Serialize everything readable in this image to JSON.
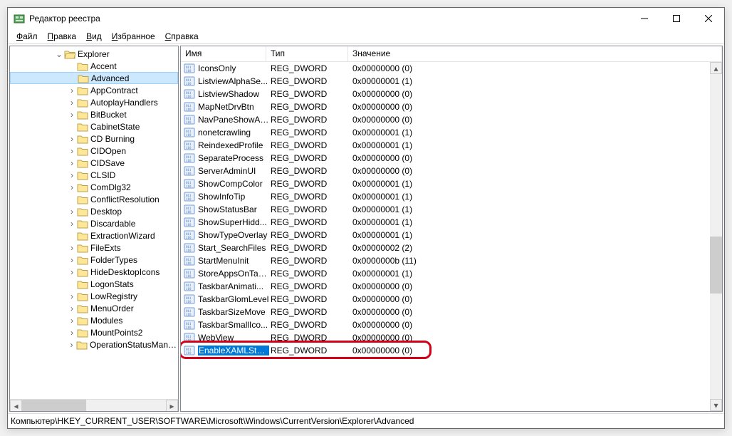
{
  "window": {
    "title": "Редактор реестра"
  },
  "menu": {
    "file": "Файл",
    "edit": "Правка",
    "view": "Вид",
    "favorites": "Избранное",
    "help": "Справка"
  },
  "tree": {
    "root": "Explorer",
    "items": [
      {
        "label": "Accent",
        "exp": ""
      },
      {
        "label": "Advanced",
        "exp": "",
        "selected": true
      },
      {
        "label": "AppContract",
        "exp": ">"
      },
      {
        "label": "AutoplayHandlers",
        "exp": ">"
      },
      {
        "label": "BitBucket",
        "exp": ">"
      },
      {
        "label": "CabinetState",
        "exp": ""
      },
      {
        "label": "CD Burning",
        "exp": ">"
      },
      {
        "label": "CIDOpen",
        "exp": ">"
      },
      {
        "label": "CIDSave",
        "exp": ">"
      },
      {
        "label": "CLSID",
        "exp": ">"
      },
      {
        "label": "ComDlg32",
        "exp": ">"
      },
      {
        "label": "ConflictResolution",
        "exp": ""
      },
      {
        "label": "Desktop",
        "exp": ">"
      },
      {
        "label": "Discardable",
        "exp": ">"
      },
      {
        "label": "ExtractionWizard",
        "exp": ""
      },
      {
        "label": "FileExts",
        "exp": ">"
      },
      {
        "label": "FolderTypes",
        "exp": ">"
      },
      {
        "label": "HideDesktopIcons",
        "exp": ">"
      },
      {
        "label": "LogonStats",
        "exp": ""
      },
      {
        "label": "LowRegistry",
        "exp": ">"
      },
      {
        "label": "MenuOrder",
        "exp": ">"
      },
      {
        "label": "Modules",
        "exp": ">"
      },
      {
        "label": "MountPoints2",
        "exp": ">"
      },
      {
        "label": "OperationStatusManager",
        "exp": ">"
      }
    ]
  },
  "columns": {
    "name": "Имя",
    "type": "Тип",
    "value": "Значение"
  },
  "values": [
    {
      "name": "IconsOnly",
      "type": "REG_DWORD",
      "data": "0x00000000 (0)"
    },
    {
      "name": "ListviewAlphaSe...",
      "type": "REG_DWORD",
      "data": "0x00000001 (1)"
    },
    {
      "name": "ListviewShadow",
      "type": "REG_DWORD",
      "data": "0x00000000 (0)"
    },
    {
      "name": "MapNetDrvBtn",
      "type": "REG_DWORD",
      "data": "0x00000000 (0)"
    },
    {
      "name": "NavPaneShowAl...",
      "type": "REG_DWORD",
      "data": "0x00000000 (0)"
    },
    {
      "name": "nonetcrawling",
      "type": "REG_DWORD",
      "data": "0x00000001 (1)"
    },
    {
      "name": "ReindexedProfile",
      "type": "REG_DWORD",
      "data": "0x00000001 (1)"
    },
    {
      "name": "SeparateProcess",
      "type": "REG_DWORD",
      "data": "0x00000000 (0)"
    },
    {
      "name": "ServerAdminUI",
      "type": "REG_DWORD",
      "data": "0x00000000 (0)"
    },
    {
      "name": "ShowCompColor",
      "type": "REG_DWORD",
      "data": "0x00000001 (1)"
    },
    {
      "name": "ShowInfoTip",
      "type": "REG_DWORD",
      "data": "0x00000001 (1)"
    },
    {
      "name": "ShowStatusBar",
      "type": "REG_DWORD",
      "data": "0x00000001 (1)"
    },
    {
      "name": "ShowSuperHidd...",
      "type": "REG_DWORD",
      "data": "0x00000001 (1)"
    },
    {
      "name": "ShowTypeOverlay",
      "type": "REG_DWORD",
      "data": "0x00000001 (1)"
    },
    {
      "name": "Start_SearchFiles",
      "type": "REG_DWORD",
      "data": "0x00000002 (2)"
    },
    {
      "name": "StartMenuInit",
      "type": "REG_DWORD",
      "data": "0x0000000b (11)"
    },
    {
      "name": "StoreAppsOnTas...",
      "type": "REG_DWORD",
      "data": "0x00000001 (1)"
    },
    {
      "name": "TaskbarAnimati...",
      "type": "REG_DWORD",
      "data": "0x00000000 (0)"
    },
    {
      "name": "TaskbarGlomLevel",
      "type": "REG_DWORD",
      "data": "0x00000000 (0)"
    },
    {
      "name": "TaskbarSizeMove",
      "type": "REG_DWORD",
      "data": "0x00000000 (0)"
    },
    {
      "name": "TaskbarSmallIco...",
      "type": "REG_DWORD",
      "data": "0x00000000 (0)"
    },
    {
      "name": "WebView",
      "type": "REG_DWORD",
      "data": "0x00000000 (0)"
    },
    {
      "name": "EnableXAMLStar...",
      "type": "REG_DWORD",
      "data": "0x00000000 (0)",
      "selected": true,
      "highlighted": true
    }
  ],
  "status": {
    "path": "Компьютер\\HKEY_CURRENT_USER\\SOFTWARE\\Microsoft\\Windows\\CurrentVersion\\Explorer\\Advanced"
  }
}
